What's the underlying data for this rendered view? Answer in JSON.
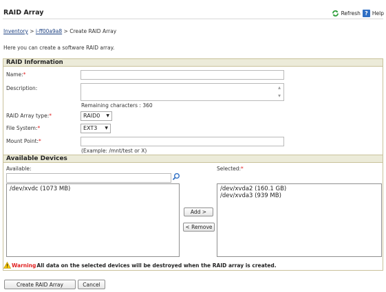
{
  "header": {
    "title": "RAID Array",
    "refresh_label": "Refresh",
    "help_label": "Help"
  },
  "breadcrumb": {
    "inventory": "Inventory",
    "separator1": ">",
    "instance": "i-ff00a9a8",
    "separator2": ">",
    "current": "Create RAID Array"
  },
  "intro_text": "Here you can create a software RAID array.",
  "raid_info": {
    "section_title": "RAID Information",
    "name_label": "Name:",
    "name_value": "",
    "description_label": "Description:",
    "description_value": "",
    "remaining_chars": "Remaining characters : 360",
    "type_label": "RAID Array type:",
    "type_value": "RAID0",
    "fs_label": "File System:",
    "fs_value": "EXT3",
    "mount_label": "Mount Point:",
    "mount_value": "",
    "mount_hint": "(Example: /mnt/test or X)",
    "required_mark": "*"
  },
  "devices": {
    "section_title": "Available Devices",
    "available_label": "Available:",
    "selected_label": "Selected:",
    "search_value": "",
    "available": [
      "/dev/xvdc (1073 MB)"
    ],
    "selected": [
      "/dev/xvda2 (160.1 GB)",
      "/dev/xvda3 (939 MB)"
    ],
    "add_label": "Add >",
    "remove_label": "< Remove"
  },
  "warning": {
    "word": "Warning",
    "text": "All data on the selected devices will be destroyed when the RAID array is created."
  },
  "actions": {
    "create_label": "Create RAID Array",
    "cancel_label": "Cancel"
  },
  "colors": {
    "section_bg": "#ecebd9",
    "border": "#c9c19a",
    "required": "#e02020",
    "link": "#1a3f80"
  }
}
